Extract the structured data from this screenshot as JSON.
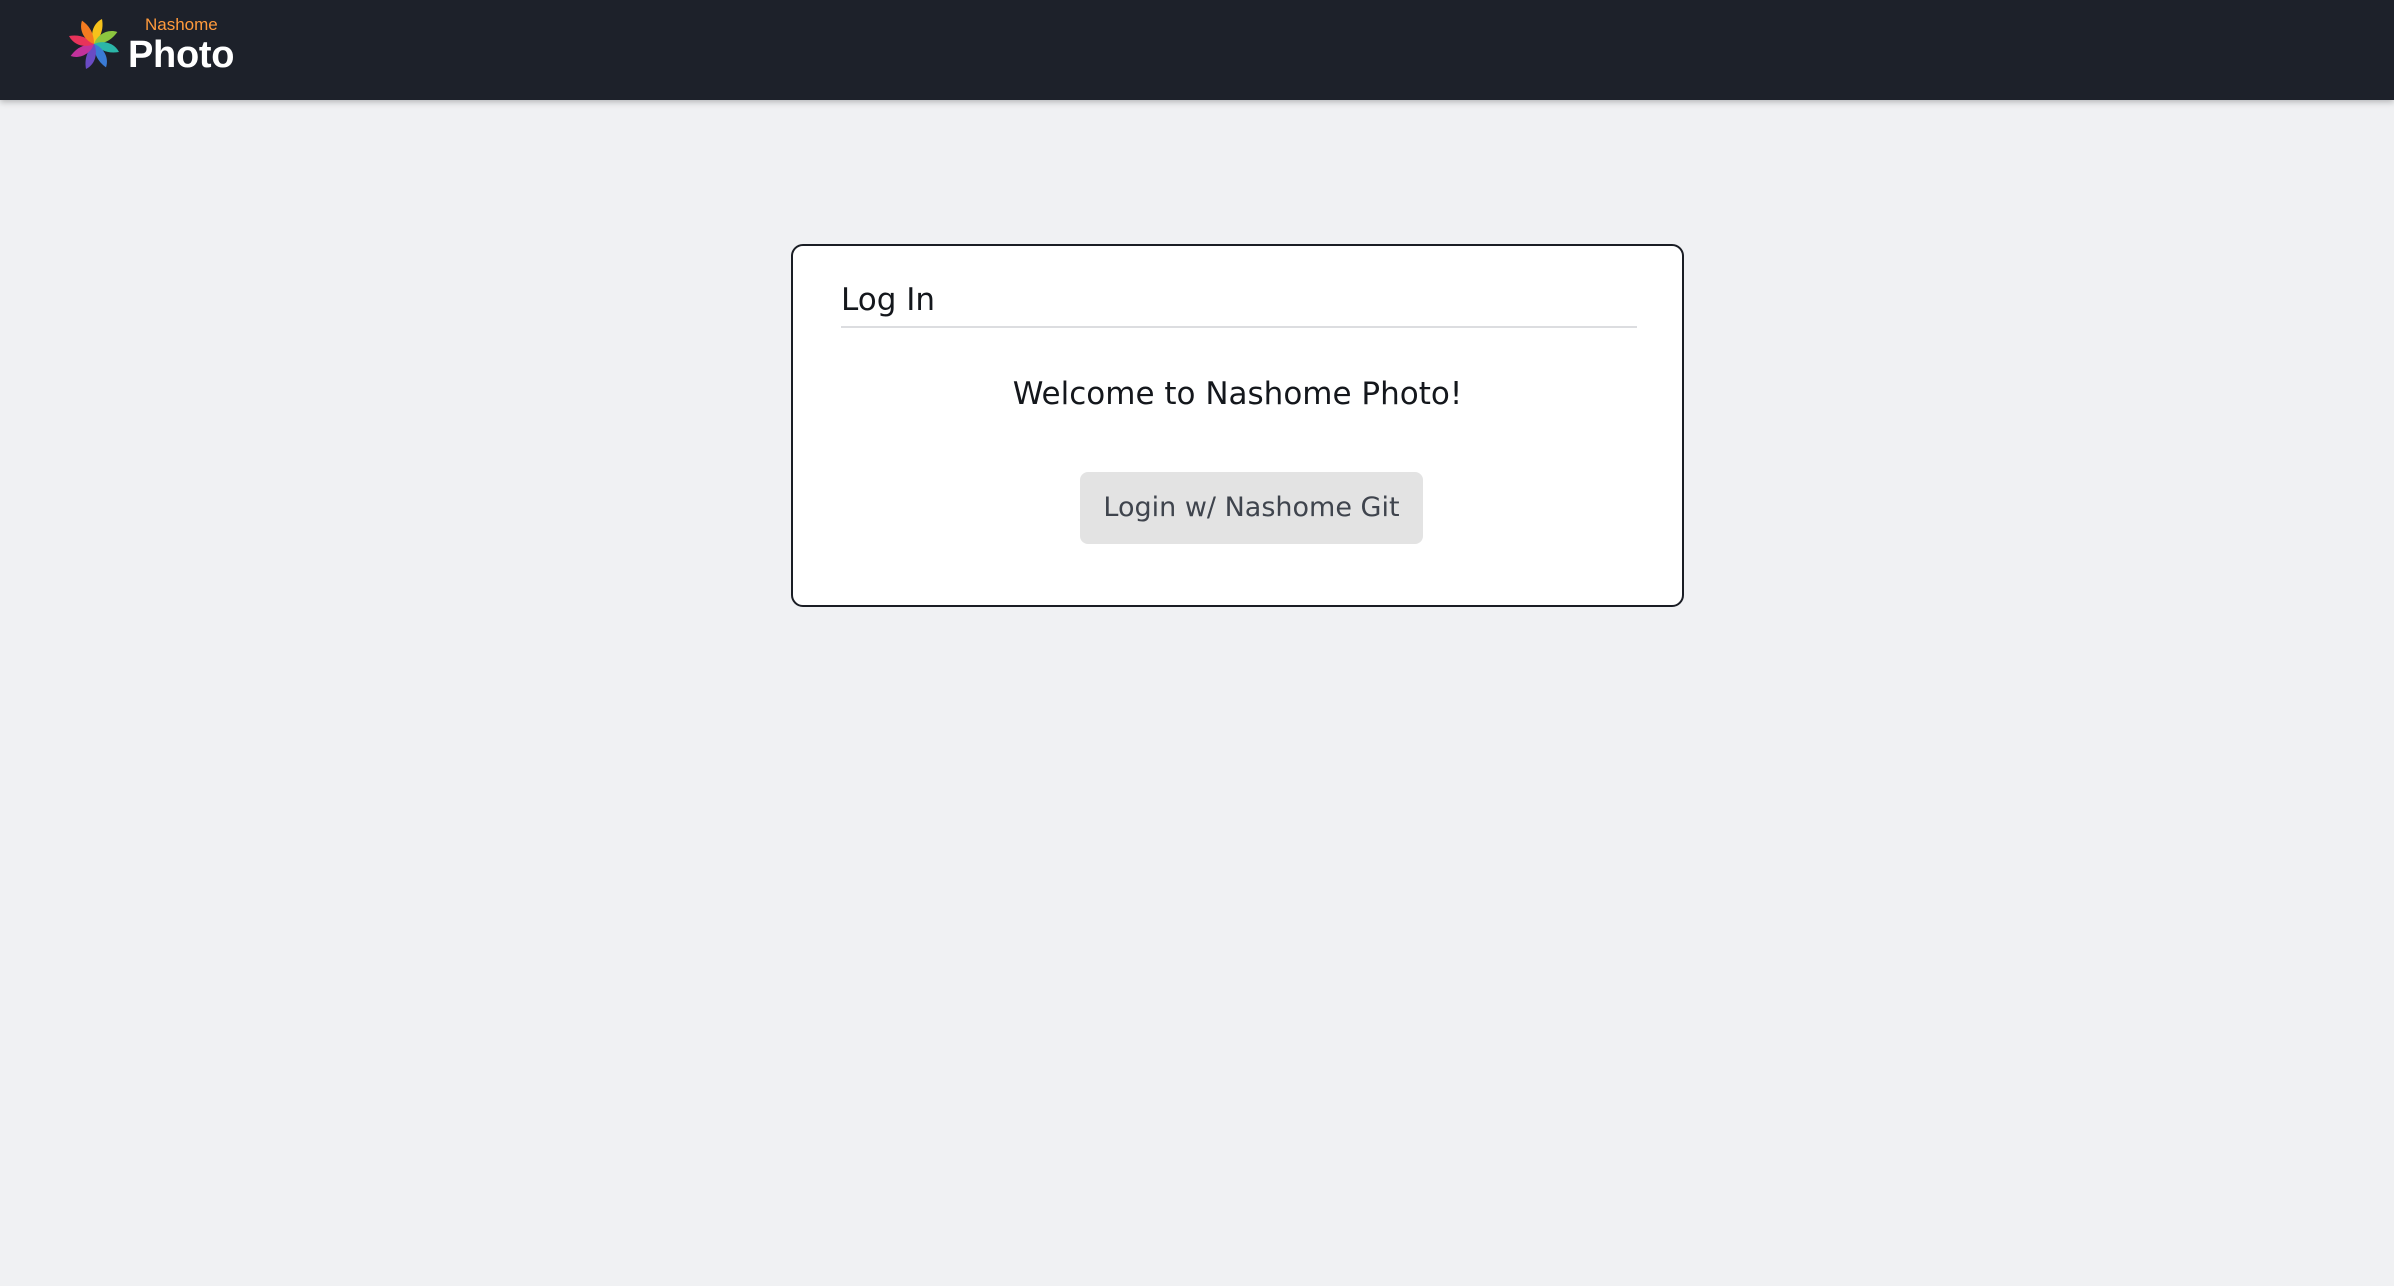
{
  "header": {
    "brand_small": "Nashome",
    "brand_big": "Photo",
    "logo_icon": "pinwheel-logo-icon",
    "background_color": "#1d212a",
    "brand_small_color": "#ff9a3c"
  },
  "login_card": {
    "title": "Log In",
    "welcome_text": "Welcome to Nashome Photo!",
    "login_button_label": "Login w/ Nashome Git"
  },
  "colors": {
    "page_background": "#f0f1f3",
    "card_background": "#ffffff",
    "button_background": "#e3e3e3"
  }
}
